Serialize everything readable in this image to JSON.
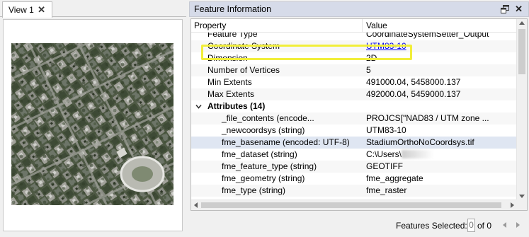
{
  "view": {
    "tab_label": "View 1",
    "close_glyph": "✕",
    "image_icon": "aerial-photo-raster"
  },
  "panel": {
    "title": "Feature Information",
    "float_icon": "float-window-icon",
    "close_glyph": "✕",
    "columns": {
      "property": "Property",
      "value": "Value"
    }
  },
  "rows": {
    "feature_type": {
      "property": "Feature Type",
      "value": "CoordinateSystemSetter_Output"
    },
    "coordinate_system": {
      "property": "Coordinate System",
      "value": "UTM83-10"
    },
    "dimension": {
      "property": "Dimension",
      "value": "2D"
    },
    "num_vertices": {
      "property": "Number of Vertices",
      "value": "5"
    },
    "min_extents": {
      "property": "Min Extents",
      "value": "491000.04, 5458000.137"
    },
    "max_extents": {
      "property": "Max Extents",
      "value": "492000.04, 5459000.137"
    },
    "attributes_group": {
      "label": "Attributes (14)"
    },
    "attributes": [
      {
        "property": "_file_contents (encode...",
        "value": "PROJCS[\"NAD83 / UTM zone ..."
      },
      {
        "property": "_newcoordsys (string)",
        "value": "UTM83-10"
      },
      {
        "property": "fme_basename (encoded: UTF-8)",
        "value": "StadiumOrthoNoCoordsys.tif"
      },
      {
        "property": "fme_dataset (string)",
        "value": "C:\\Users\\"
      },
      {
        "property": "fme_feature_type (string)",
        "value": "GEOTIFF"
      },
      {
        "property": "fme_geometry (string)",
        "value": "fme_aggregate"
      },
      {
        "property": "fme_type (string)",
        "value": "fme_raster"
      }
    ]
  },
  "footer": {
    "selected_label": "Features Selected:",
    "selected_count": "0",
    "of_total": "of 0"
  },
  "colors": {
    "highlight": "#f1ee3a",
    "title_bar": "#d6dbe9",
    "link": "#0000ee",
    "selected_row": "#dfe6f2"
  }
}
